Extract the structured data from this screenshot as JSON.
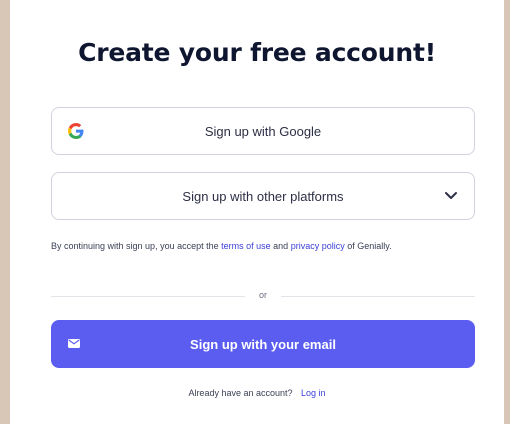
{
  "title": "Create your free account!",
  "buttons": {
    "google": "Sign up with Google",
    "platforms": "Sign up with other platforms",
    "email": "Sign up with your email"
  },
  "legal": {
    "prefix": "By continuing with sign up, you accept the",
    "terms": "terms of use",
    "and": "and",
    "privacy": "privacy policy",
    "suffix": "of Genially."
  },
  "divider": "or",
  "login": {
    "prompt": "Already have an account?",
    "link": "Log in"
  },
  "colors": {
    "accent": "#5a5df0",
    "link": "#3b3fd8",
    "title": "#0f1630",
    "background": "#d8c7b6"
  },
  "icons": [
    "google-icon",
    "chevron-down-icon",
    "mail-icon"
  ]
}
